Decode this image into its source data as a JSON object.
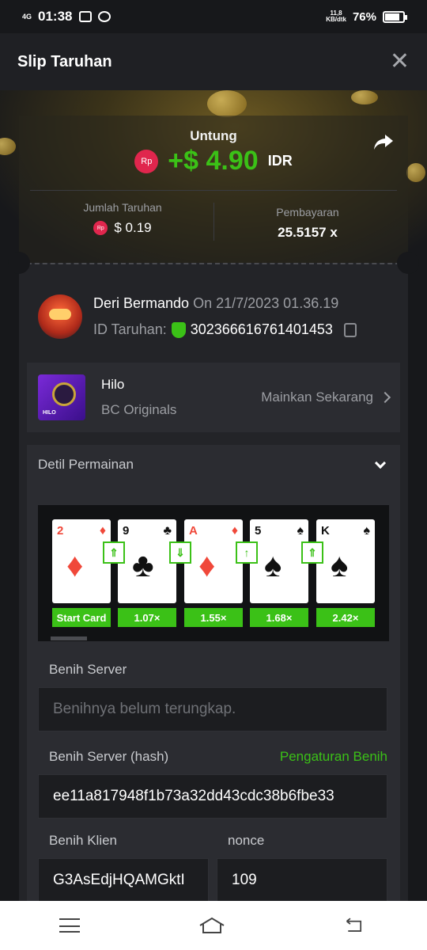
{
  "status_bar": {
    "network": "4G",
    "time": "01:38",
    "speed_top": "11,8",
    "speed_bottom": "KB/dtk",
    "battery": "76%"
  },
  "header": {
    "title": "Slip Taruhan"
  },
  "summary": {
    "profit_label": "Untung",
    "currency_badge": "Rp",
    "profit_value": "+$ 4.90",
    "currency": "IDR",
    "bet_amount_label": "Jumlah Taruhan",
    "bet_amount_value": "$ 0.19",
    "payout_label": "Pembayaran",
    "payout_value": "25.5157 x"
  },
  "user": {
    "name": "Deri Bermando",
    "date": "On 21/7/2023 01.36.19",
    "bet_id_label": "ID Taruhan:",
    "bet_id": "302366616761401453"
  },
  "game": {
    "thumb_label": "HILO",
    "name": "Hilo",
    "provider": "BC Originals",
    "play_label": "Mainkan Sekarang"
  },
  "details": {
    "title": "Detil Permainan",
    "cards": [
      {
        "rank": "2",
        "suit": "♦",
        "color": "red",
        "multiplier": "Start Card"
      },
      {
        "rank": "9",
        "suit": "♣",
        "color": "black",
        "multiplier": "1.07×"
      },
      {
        "rank": "A",
        "suit": "♦",
        "color": "red",
        "multiplier": "1.55×"
      },
      {
        "rank": "5",
        "suit": "♠",
        "color": "black",
        "multiplier": "1.68×"
      },
      {
        "rank": "K",
        "suit": "♠",
        "color": "black",
        "multiplier": "2.42×"
      }
    ],
    "arrows": [
      "⇑",
      "⇓",
      "↑",
      "⇑"
    ],
    "server_seed_label": "Benih Server",
    "server_seed_placeholder": "Benihnya belum terungkap.",
    "server_hash_label": "Benih Server (hash)",
    "seed_settings_link": "Pengaturan Benih",
    "server_hash_value": "ee11a817948f1b73a32dd43cdc38b6fbe33",
    "client_seed_label": "Benih Klien",
    "client_seed_value": "G3AsEdjHQAMGktI",
    "nonce_label": "nonce",
    "nonce_value": "109"
  },
  "colors": {
    "accent_green": "#3bc117",
    "rp_red": "#e0264d",
    "background": "#17181b"
  }
}
